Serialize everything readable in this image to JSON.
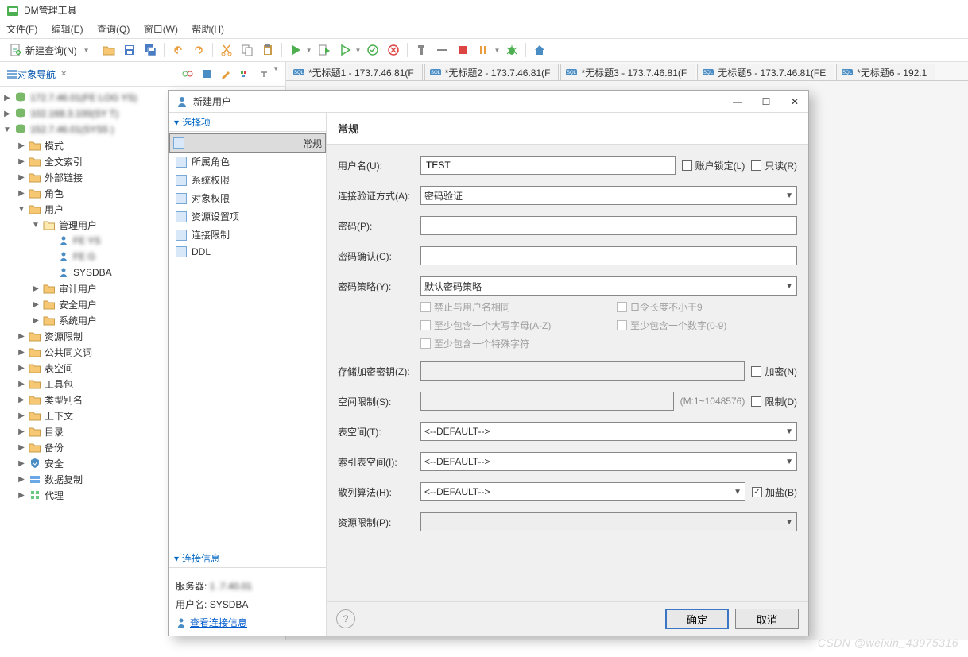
{
  "app": {
    "title": "DM管理工具"
  },
  "menu": {
    "file": "文件(F)",
    "edit": "编辑(E)",
    "query": "查询(Q)",
    "window": "窗口(W)",
    "help": "帮助(H)"
  },
  "toolbar": {
    "new_query": "新建查询(N)"
  },
  "nav": {
    "title": "对象导航",
    "roots": [
      "172.7.46.01(FE   LOG   YS)",
      "102.168.3.100(SY     T)",
      "152.7.46.01(SYS5   )"
    ],
    "nodes": {
      "mode": "模式",
      "fulltext": "全文索引",
      "external": "外部链接",
      "roles": "角色",
      "users": "用户",
      "admin_users": "管理用户",
      "u1": "FE        YS",
      "u2": "FE       G",
      "u3": "SYSDBA",
      "audit_users": "审计用户",
      "security_users": "安全用户",
      "system_users": "系统用户",
      "resource_limit": "资源限制",
      "synonyms": "公共同义词",
      "tablespace": "表空间",
      "toolkit": "工具包",
      "type_alias": "类型别名",
      "context": "上下文",
      "catalog": "目录",
      "backup": "备份",
      "security": "安全",
      "replication": "数据复制",
      "agent": "代理"
    }
  },
  "tabs": [
    "*无标题1 - 173.7.46.81(F",
    "*无标题2 - 173.7.46.81(F",
    "*无标题3 - 173.7.46.81(F",
    "无标题5 - 173.7.46.81(FE",
    "*无标题6 - 192.1"
  ],
  "dialog": {
    "title": "新建用户",
    "section_options": "选择项",
    "options": [
      "常规",
      "所属角色",
      "系统权限",
      "对象权限",
      "资源设置项",
      "连接限制",
      "DDL"
    ],
    "section_conn": "连接信息",
    "conn": {
      "server_label": "服务器:",
      "server_value": "1   .7.40.01",
      "user_label": "用户名:",
      "user_value": "SYSDBA",
      "link": "查看连接信息"
    },
    "form": {
      "header": "常规",
      "username_lbl": "用户名(U):",
      "username_val": "TEST",
      "lock_lbl": "账户锁定(L)",
      "readonly_lbl": "只读(R)",
      "auth_lbl": "连接验证方式(A):",
      "auth_val": "密码验证",
      "pwd_lbl": "密码(P):",
      "pwd_confirm_lbl": "密码确认(C):",
      "policy_lbl": "密码策略(Y):",
      "policy_val": "默认密码策略",
      "policy_opts": [
        "禁止与用户名相同",
        "口令长度不小于9",
        "至少包含一个大写字母(A-Z)",
        "至少包含一个数字(0-9)",
        "至少包含一个特殊字符"
      ],
      "storekey_lbl": "存储加密密钥(Z):",
      "encrypt_lbl": "加密(N)",
      "space_lbl": "空间限制(S):",
      "space_hint": "(M:1~1048576)",
      "limit_lbl": "限制(D)",
      "tablespace_lbl": "表空间(T):",
      "default_opt": "<--DEFAULT-->",
      "idx_tbs_lbl": "索引表空间(I):",
      "hash_lbl": "散列算法(H):",
      "salt_lbl": "加盐(B)",
      "resource_lbl": "资源限制(P):"
    },
    "buttons": {
      "ok": "确定",
      "cancel": "取消"
    }
  },
  "watermark": "CSDN @weixin_43975316"
}
